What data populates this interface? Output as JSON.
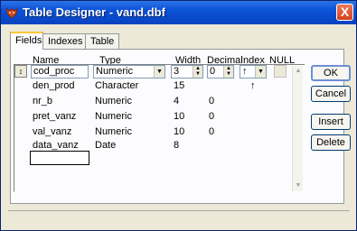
{
  "window": {
    "title": "Table Designer - vand.dbf",
    "close_label": "X"
  },
  "tabs": [
    {
      "label": "Fields"
    },
    {
      "label": "Indexes"
    },
    {
      "label": "Table"
    }
  ],
  "columns": {
    "name": "Name",
    "type": "Type",
    "width": "Width",
    "decimal": "Decimal",
    "index": "Index",
    "null": "NULL"
  },
  "edit_row": {
    "selector": "↕",
    "name_value": "cod_proc",
    "type_value": "Numeric",
    "width_value": "3",
    "decimal_value": "0",
    "index_value": "↑"
  },
  "rows": [
    {
      "name": "den_prod",
      "type": "Character",
      "width": "15",
      "decimal": "",
      "index": "↑"
    },
    {
      "name": "nr_b",
      "type": "Numeric",
      "width": "4",
      "decimal": "0",
      "index": ""
    },
    {
      "name": "pret_vanz",
      "type": "Numeric",
      "width": "10",
      "decimal": "0",
      "index": ""
    },
    {
      "name": "val_vanz",
      "type": "Numeric",
      "width": "10",
      "decimal": "0",
      "index": ""
    },
    {
      "name": "data_vanz",
      "type": "Date",
      "width": "8",
      "decimal": "",
      "index": ""
    }
  ],
  "new_row": {
    "name_value": ""
  },
  "buttons": {
    "ok": "OK",
    "cancel": "Cancel",
    "insert": "Insert",
    "delete": "Delete"
  }
}
